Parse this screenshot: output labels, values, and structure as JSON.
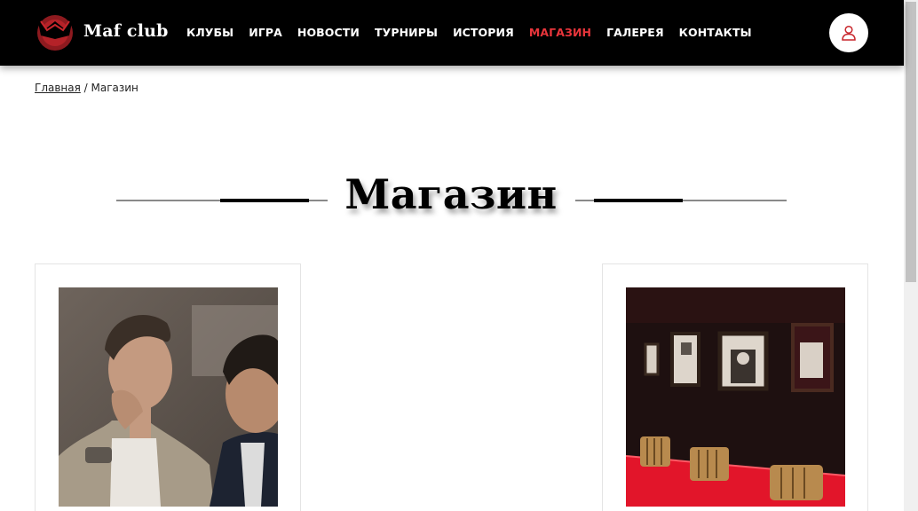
{
  "header": {
    "brand": "Maf club",
    "nav": [
      {
        "label": "КЛУБЫ"
      },
      {
        "label": "ИГРА"
      },
      {
        "label": "НОВОСТИ"
      },
      {
        "label": "ТУРНИРЫ"
      },
      {
        "label": "ИСТОРИЯ"
      },
      {
        "label": "МАГАЗИН"
      },
      {
        "label": "ГАЛЕРЕЯ"
      },
      {
        "label": "КОНТАКТЫ"
      }
    ],
    "active_nav": "МАГАЗИН",
    "user_icon": "user-icon"
  },
  "breadcrumb": {
    "home": "Главная",
    "separator": " / ",
    "current": "Магазин"
  },
  "page": {
    "title": "Магазин"
  },
  "colors": {
    "header_bg": "#000000",
    "accent": "#e8353b",
    "text": "#111111"
  },
  "products": [
    {
      "image": "men-photo"
    },
    {
      "image": "club-room-photo"
    }
  ]
}
